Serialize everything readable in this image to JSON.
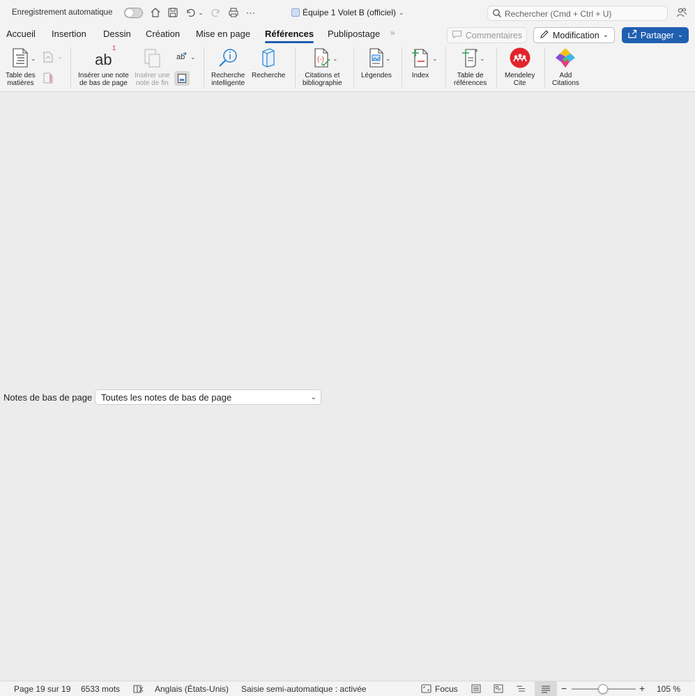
{
  "titlebar": {
    "autosave_label": "Enregistrement automatique",
    "document_title": "Équipe 1 Volet B (officiel)",
    "search_placeholder": "Rechercher (Cmd + Ctrl + U)"
  },
  "tabs": [
    {
      "label": "Accueil"
    },
    {
      "label": "Insertion"
    },
    {
      "label": "Dessin"
    },
    {
      "label": "Création"
    },
    {
      "label": "Mise en page"
    },
    {
      "label": "Références",
      "active": true
    },
    {
      "label": "Publipostage"
    }
  ],
  "actions": {
    "comments_label": "Commentaires",
    "edit_label": "Modification",
    "share_label": "Partager"
  },
  "ribbon": {
    "toc_label_1": "Table des",
    "toc_label_2": "matières",
    "insert_footnote_1": "Insérer une note",
    "insert_footnote_2": "de bas de page",
    "insert_endnote_1": "Insérer une",
    "insert_endnote_2": "note de fin",
    "smart_lookup_1": "Recherche",
    "smart_lookup_2": "intelligente",
    "research": "Recherche",
    "citations_1": "Citations et",
    "citations_2": "bibliographie",
    "captions": "Légendes",
    "index": "Index",
    "table_auth_1": "Table de",
    "table_auth_2": "références",
    "mendeley_1": "Mendeley",
    "mendeley_2": "Cite",
    "add_citations_1": "Add",
    "add_citations_2": "Citations",
    "footnote_glyph": "ab",
    "footnote_sup": "1"
  },
  "footnotes": {
    "label": "Notes de bas de page",
    "selected": "Toutes les notes de bas de page"
  },
  "statusbar": {
    "page": "Page 19 sur 19",
    "words": "6533 mots",
    "language": "Anglais (États-Unis)",
    "autocomplete": "Saisie semi-automatique : activée",
    "focus": "Focus",
    "zoom": "105 %",
    "zoom_percent": 105
  },
  "colors": {
    "accent": "#1f5fb0",
    "mendeley": "#e2242b"
  }
}
